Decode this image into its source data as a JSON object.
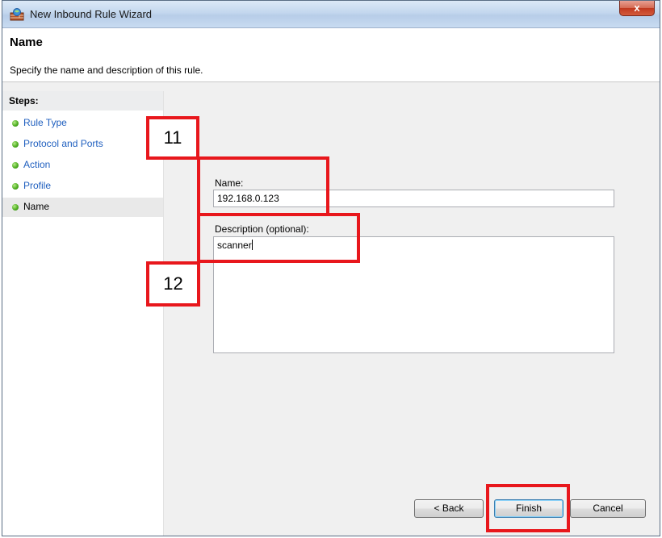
{
  "window": {
    "title": "New Inbound Rule Wizard",
    "close_glyph": "x"
  },
  "header": {
    "title": "Name",
    "subtitle": "Specify the name and description of this rule."
  },
  "steps": {
    "heading": "Steps:",
    "items": [
      {
        "label": "Rule Type"
      },
      {
        "label": "Protocol and Ports"
      },
      {
        "label": "Action"
      },
      {
        "label": "Profile"
      },
      {
        "label": "Name"
      }
    ]
  },
  "form": {
    "name_label": "Name:",
    "name_value": "192.168.0.123",
    "description_label": "Description (optional):",
    "description_value": "scanner"
  },
  "buttons": {
    "back": "< Back",
    "finish": "Finish",
    "cancel": "Cancel"
  },
  "annotations": {
    "callout_1": "11",
    "callout_2": "12"
  },
  "colors": {
    "annotation": "#e8171c",
    "step_link": "#1f5fbf",
    "step_dot": "#4fae21"
  },
  "icons": {
    "title": "firewall-icon",
    "step": "green-bullet-icon"
  }
}
